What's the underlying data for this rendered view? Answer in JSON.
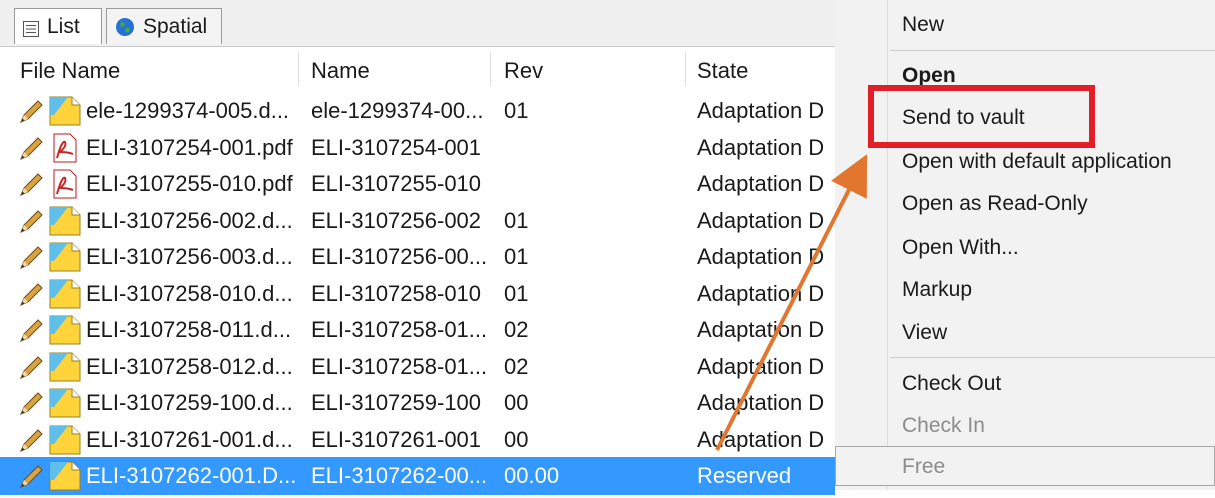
{
  "tabs": [
    {
      "label": "List",
      "icon": "list-icon",
      "active": true
    },
    {
      "label": "Spatial",
      "icon": "globe-icon",
      "active": false
    }
  ],
  "columns": [
    "File Name",
    "Name",
    "Rev",
    "State"
  ],
  "rows": [
    {
      "file": "ele-1299374-005.d...",
      "name": "ele-1299374-00...",
      "rev": "01",
      "state": "Adaptation D",
      "icon": "drawing-icon"
    },
    {
      "file": "ELI-3107254-001.pdf",
      "name": "ELI-3107254-001",
      "rev": "",
      "state": "Adaptation D",
      "icon": "pdf-icon"
    },
    {
      "file": "ELI-3107255-010.pdf",
      "name": "ELI-3107255-010",
      "rev": "",
      "state": "Adaptation D",
      "icon": "pdf-icon"
    },
    {
      "file": "ELI-3107256-002.d...",
      "name": "ELI-3107256-002",
      "rev": "01",
      "state": "Adaptation D",
      "icon": "drawing-icon"
    },
    {
      "file": "ELI-3107256-003.d...",
      "name": "ELI-3107256-00...",
      "rev": "01",
      "state": "Adaptation D",
      "icon": "drawing-icon"
    },
    {
      "file": "ELI-3107258-010.d...",
      "name": "ELI-3107258-010",
      "rev": "01",
      "state": "Adaptation D",
      "icon": "drawing-icon"
    },
    {
      "file": "ELI-3107258-011.d...",
      "name": "ELI-3107258-01...",
      "rev": "02",
      "state": "Adaptation D",
      "icon": "drawing-icon"
    },
    {
      "file": "ELI-3107258-012.d...",
      "name": "ELI-3107258-01...",
      "rev": "02",
      "state": "Adaptation D",
      "icon": "drawing-icon"
    },
    {
      "file": "ELI-3107259-100.d...",
      "name": "ELI-3107259-100",
      "rev": "00",
      "state": "Adaptation D",
      "icon": "drawing-icon"
    },
    {
      "file": "ELI-3107261-001.d...",
      "name": "ELI-3107261-001",
      "rev": "00",
      "state": "Adaptation D",
      "icon": "drawing-icon"
    },
    {
      "file": "ELI-3107262-001.D...",
      "name": "ELI-3107262-00...",
      "rev": "00.00",
      "state": "Reserved",
      "icon": "drawing-icon",
      "selected": true
    }
  ],
  "menu": {
    "new": "New",
    "open": "Open",
    "send_to_vault": "Send to vault",
    "open_default": "Open with default application",
    "open_readonly": "Open as Read-Only",
    "open_with": "Open With...",
    "markup": "Markup",
    "view": "View",
    "check_out": "Check Out",
    "check_in": "Check In",
    "free": "Free"
  },
  "colors": {
    "highlight_box": "#e21f26",
    "arrow": "#e2762f",
    "selected_row": "#3399ff"
  }
}
